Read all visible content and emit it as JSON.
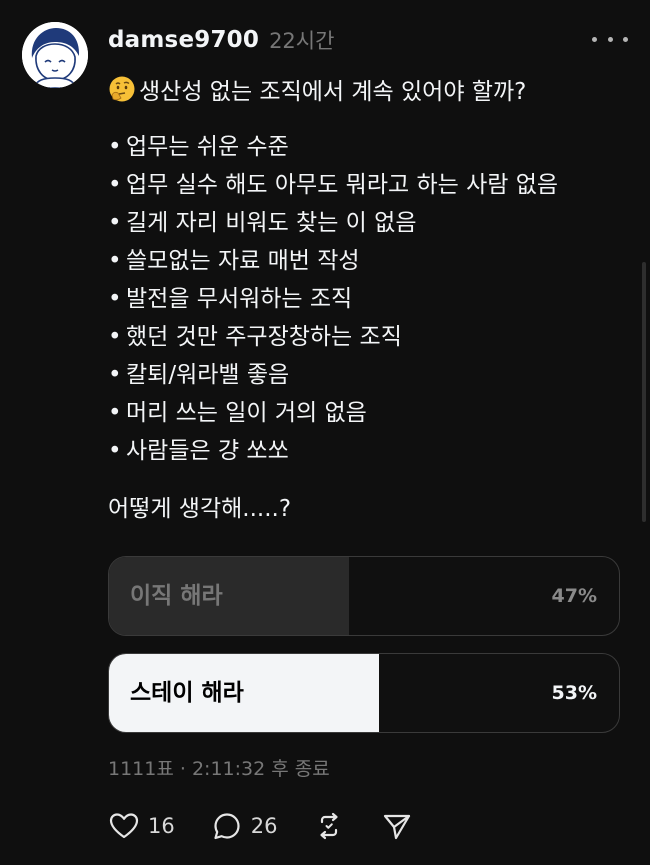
{
  "post": {
    "username": "damse9700",
    "timestamp": "22시간",
    "title": "생산성 없는 조직에서 계속 있어야 할까?",
    "title_emoji": "thinking-face-icon",
    "bullet_symbol": "•",
    "bullets": [
      "업무는 쉬운 수준",
      "업무 실수 해도 아무도 뭐라고 하는 사람 없음",
      "길게 자리 비워도 찾는 이 없음",
      "쓸모없는 자료 매번 작성",
      "발전을 무서워하는 조직",
      "했던 것만 주구장창하는 조직",
      "칼퇴/워라밸 좋음",
      "머리 쓰는 일이 거의 없음",
      "사람들은 걍 쏘쏘"
    ],
    "question": "어떻게 생각해.....?"
  },
  "poll": {
    "options": [
      {
        "label": "이직 해라",
        "percent_text": "47%",
        "percent": 47
      },
      {
        "label": "스테이 해라",
        "percent_text": "53%",
        "percent": 53
      }
    ],
    "meta": "1111표 · 2:11:32 후 종료"
  },
  "actions": {
    "likes": "16",
    "comments": "26"
  },
  "colors": {
    "background": "#0f0f0f",
    "text": "#f3f5f7",
    "muted": "#777777",
    "poll_selected": "#f3f5f7",
    "poll_unselected": "#2a2a2a"
  }
}
